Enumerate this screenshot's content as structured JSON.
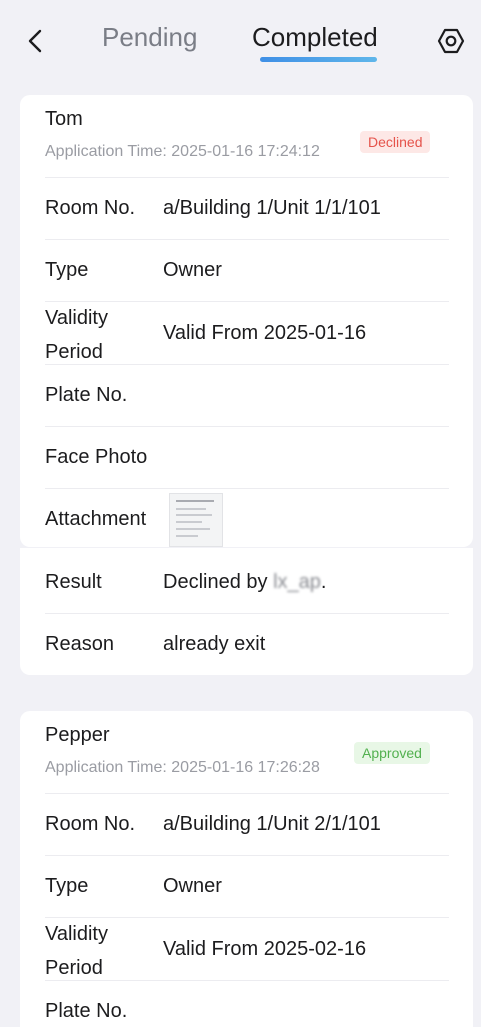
{
  "header": {
    "tabs": [
      {
        "label": "Pending",
        "active": false
      },
      {
        "label": "Completed",
        "active": true
      }
    ],
    "accent_color": "#3f8fe6"
  },
  "cards": [
    {
      "name": "Tom",
      "application_time": "Application Time: 2025-01-16 17:24:12",
      "status": "Declined",
      "fields": {
        "room_label": "Room No.",
        "room_value": "a/Building 1/Unit 1/1/101",
        "type_label": "Type",
        "type_value": "Owner",
        "validity_label_1": "Validity",
        "validity_label_2": "Period",
        "validity_value": "Valid From 2025-01-16",
        "plate_label": "Plate No.",
        "face_label": "Face Photo",
        "attachment_label": "Attachment",
        "result_label": "Result",
        "result_prefix": "Declined by ",
        "result_user": "lx_ap",
        "result_suffix": ".",
        "reason_label": "Reason",
        "reason_value": "already exit"
      }
    },
    {
      "name": "Pepper",
      "application_time": "Application Time: 2025-01-16 17:26:28",
      "status": "Approved",
      "fields": {
        "room_label": "Room No.",
        "room_value": "a/Building 1/Unit 2/1/101",
        "type_label": "Type",
        "type_value": "Owner",
        "validity_label_1": "Validity",
        "validity_label_2": "Period",
        "validity_value": "Valid From 2025-02-16",
        "plate_label": "Plate No."
      }
    }
  ]
}
